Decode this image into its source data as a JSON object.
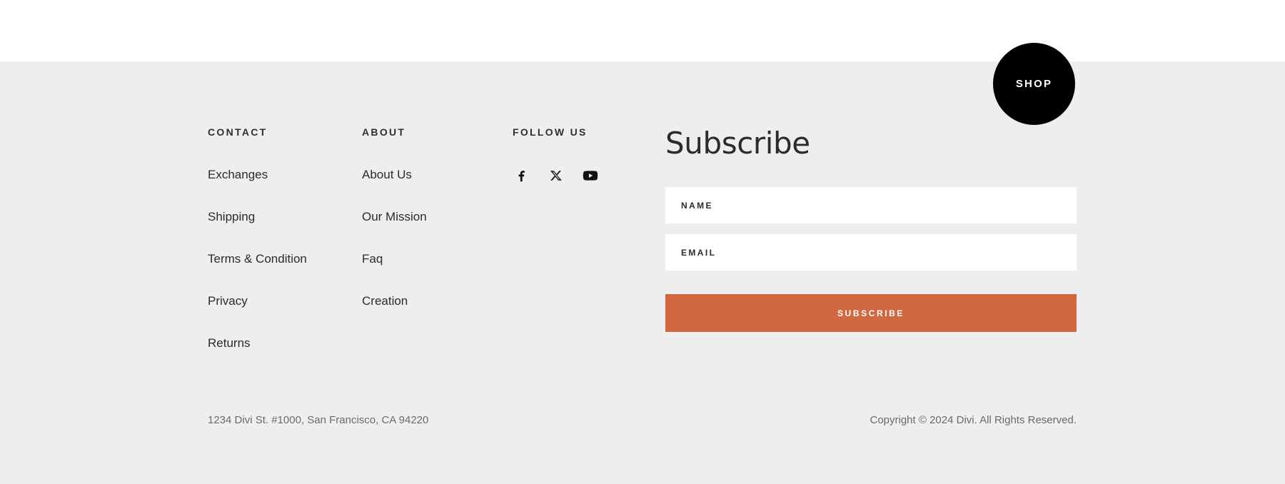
{
  "shop_badge": {
    "label": "SHOP"
  },
  "columns": [
    {
      "id": "contact",
      "title": "CONTACT",
      "links": [
        {
          "label": "Exchanges"
        },
        {
          "label": "Shipping"
        },
        {
          "label": "Terms & Condition"
        },
        {
          "label": "Privacy"
        },
        {
          "label": "Returns"
        }
      ]
    },
    {
      "id": "about",
      "title": "ABOUT",
      "links": [
        {
          "label": "About Us"
        },
        {
          "label": "Our Mission"
        },
        {
          "label": "Faq"
        },
        {
          "label": "Creation"
        }
      ]
    }
  ],
  "follow": {
    "title": "FOLLOW US",
    "icons": [
      {
        "name": "facebook-icon"
      },
      {
        "name": "x-twitter-icon"
      },
      {
        "name": "youtube-icon"
      }
    ]
  },
  "subscribe": {
    "title": "Subscribe",
    "name_field": {
      "placeholder": "NAME",
      "value": ""
    },
    "email_field": {
      "placeholder": "EMAIL",
      "value": ""
    },
    "button_label": "SUBSCRIBE"
  },
  "bottom": {
    "address": "1234 Divi St. #1000, San Francisco, CA 94220",
    "copyright": "Copyright © 2024 Divi. All Rights Reserved."
  },
  "colors": {
    "footer_background": "#eeeeee",
    "page_background": "#ffffff",
    "accent_orange": "#d2683f",
    "badge_black": "#000000",
    "text_dark": "#2b2b2b",
    "text_muted": "#6b6b6b"
  }
}
